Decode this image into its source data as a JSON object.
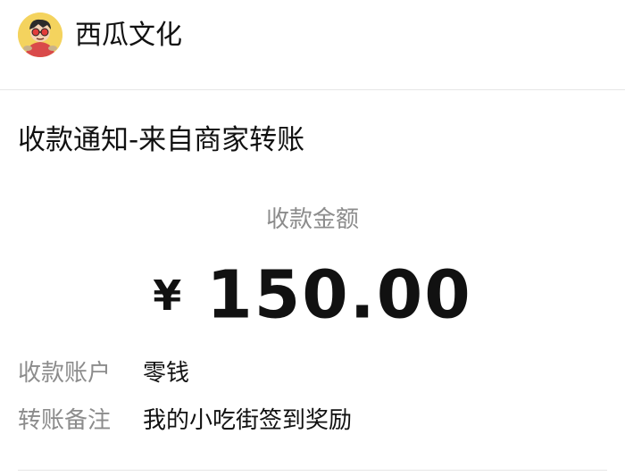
{
  "header": {
    "account_name": "西瓜文化",
    "avatar_icon": "cartoon-avatar-icon"
  },
  "notice": {
    "title": "收款通知-来自商家转账"
  },
  "amount": {
    "label": "收款金额",
    "currency": "¥",
    "value": "150.00"
  },
  "details": [
    {
      "label": "收款账户",
      "value": "零钱"
    },
    {
      "label": "转账备注",
      "value": "我的小吃街签到奖励"
    }
  ],
  "colors": {
    "primary_text": "#111111",
    "secondary_text": "#8c8c8c",
    "divider": "#e6e6e6",
    "background": "#ffffff"
  }
}
